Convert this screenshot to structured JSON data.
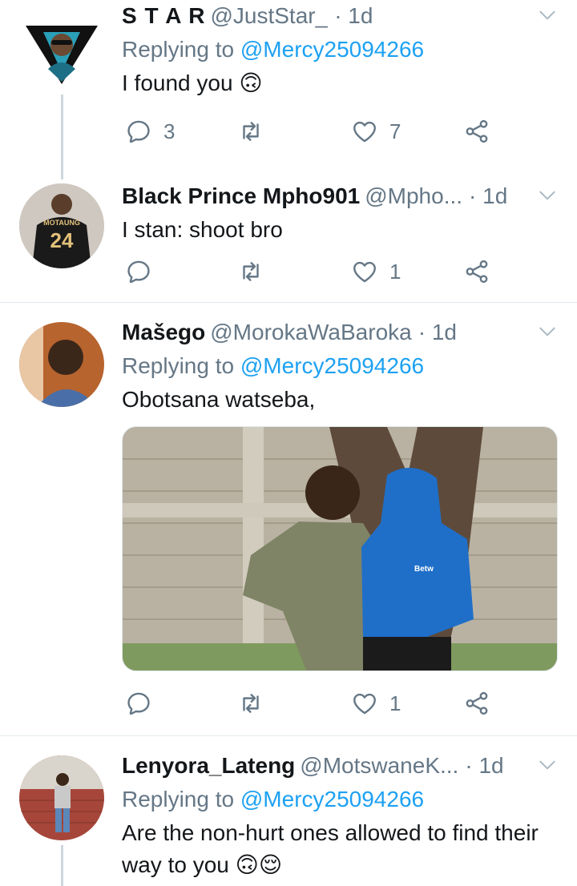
{
  "tweets": [
    {
      "name": "S T A R",
      "handle": "@JustStar_",
      "time": "· 1d",
      "replying_prefix": "Replying to ",
      "replying_to": "@Mercy25094266",
      "text": "I found you 🙃",
      "replies": "3",
      "retweets": "",
      "likes": "7"
    },
    {
      "name": "Black Prince Mpho901",
      "handle": "@Mpho...",
      "time": "· 1d",
      "text": "I stan: shoot bro",
      "avatar_jersey_text": "MOTAUNG",
      "avatar_jersey_number": "24",
      "replies": "",
      "retweets": "",
      "likes": "1"
    },
    {
      "name": "Mašego",
      "handle": "@MorokaWaBaroka",
      "time": "· 1d",
      "replying_prefix": "Replying to ",
      "replying_to": "@Mercy25094266",
      "text": "Obotsana watseba,",
      "media_shirt_text": "Betw",
      "replies": "",
      "retweets": "",
      "likes": "1"
    },
    {
      "name": "Lenyora_Lateng",
      "handle": "@MotswaneK...",
      "time": "· 1d",
      "replying_prefix": "Replying to ",
      "replying_to": "@Mercy25094266",
      "text": "Are the non-hurt ones allowed to find their way to you 🙃😌"
    }
  ],
  "colors": {
    "text": "#14171a",
    "secondary": "#657786",
    "link": "#1da1f2",
    "divider": "#e1e8ed",
    "thread_line": "#ccd6dd"
  },
  "icons": [
    "reply-icon",
    "retweet-icon",
    "like-icon",
    "share-icon",
    "chevron-down-icon"
  ]
}
